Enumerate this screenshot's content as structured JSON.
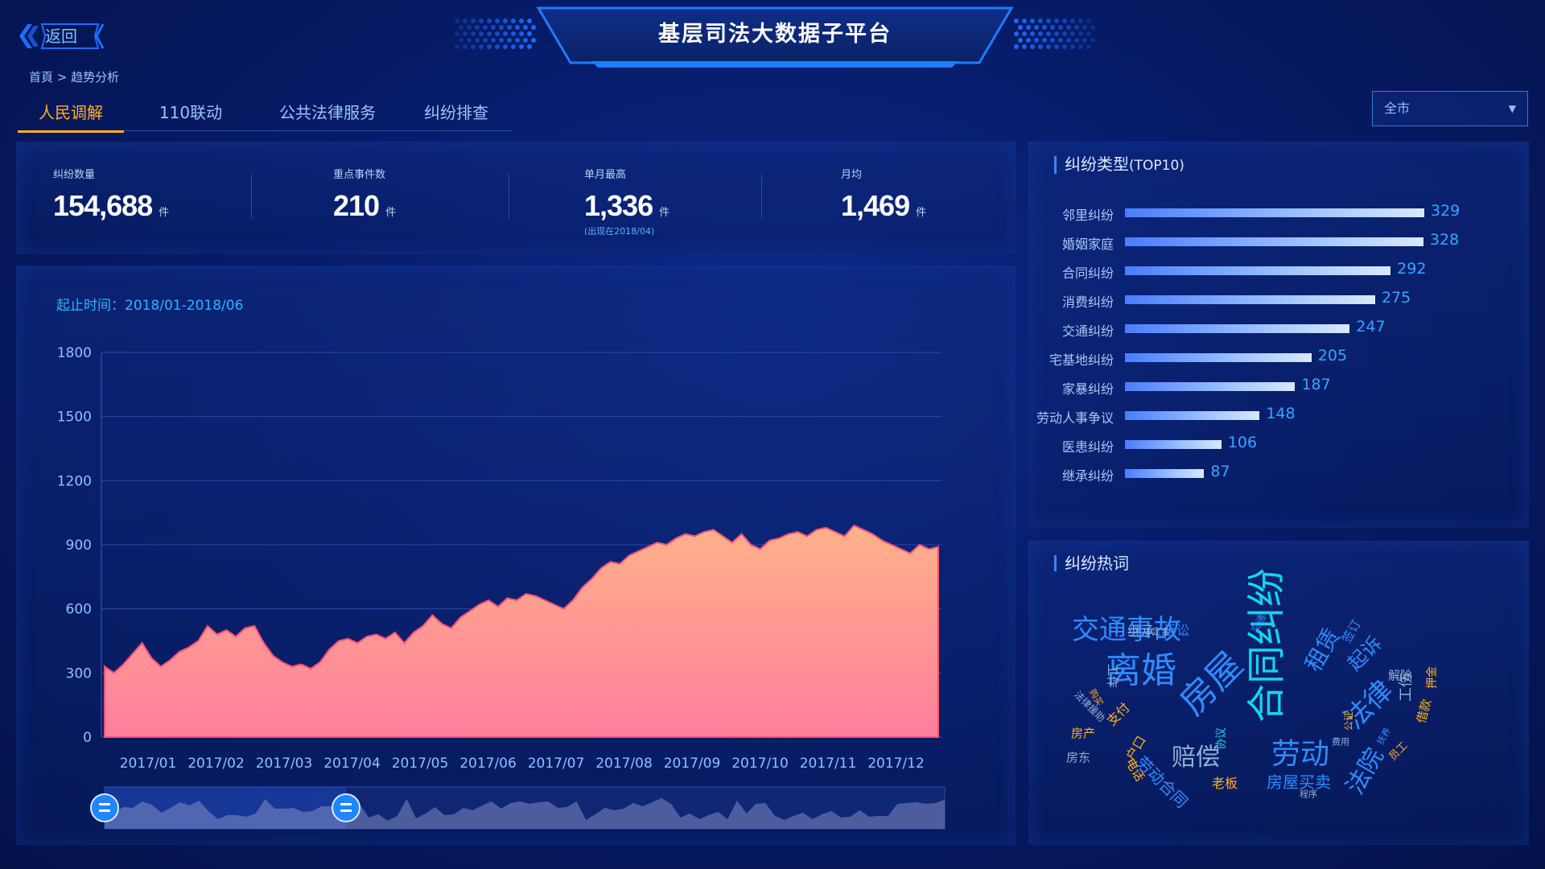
{
  "header": {
    "back_label": "返回",
    "title": "基层司法大数据子平台"
  },
  "breadcrumb": "首頁 > 趋势分析",
  "tabs": [
    "人民调解",
    "110联动",
    "公共法律服务",
    "纠纷排查"
  ],
  "region_select": {
    "value": "全市",
    "caret": "▼"
  },
  "stats": [
    {
      "label": "纠纷数量",
      "value": "154,688",
      "unit": "件",
      "note": ""
    },
    {
      "label": "重点事件数",
      "value": "210",
      "unit": "件",
      "note": ""
    },
    {
      "label": "单月最高",
      "value": "1,336",
      "unit": "件",
      "note": "(出现在2018/04)"
    },
    {
      "label": "月均",
      "value": "1,469",
      "unit": "件",
      "note": ""
    }
  ],
  "date_range": "起止时间：2018/01-2018/06",
  "colors": {
    "accent": "#2f8cff",
    "tab_active": "#ffb21f",
    "area_top": "#ffb189",
    "area_bottom": "#ff7e9d",
    "area_line": "#ff4f7b"
  },
  "chart_data": [
    {
      "type": "area",
      "title": "",
      "xlabel": "",
      "ylabel": "",
      "ylim": [
        0,
        1800
      ],
      "yticks": [
        0,
        300,
        600,
        900,
        1200,
        1500,
        1800
      ],
      "x_tick_labels": [
        "2017/01",
        "2017/02",
        "2017/03",
        "2017/04",
        "2017/05",
        "2017/06",
        "2017/07",
        "2017/08",
        "2017/09",
        "2017/10",
        "2017/11",
        "2017/12"
      ],
      "grid": true,
      "values": [
        330,
        300,
        340,
        390,
        440,
        370,
        330,
        360,
        400,
        420,
        450,
        520,
        480,
        500,
        470,
        510,
        520,
        440,
        380,
        350,
        330,
        340,
        320,
        350,
        410,
        450,
        460,
        440,
        470,
        480,
        460,
        490,
        440,
        490,
        520,
        570,
        530,
        510,
        560,
        590,
        620,
        640,
        610,
        650,
        640,
        670,
        660,
        640,
        620,
        600,
        640,
        700,
        740,
        790,
        820,
        810,
        850,
        870,
        890,
        910,
        900,
        930,
        950,
        940,
        960,
        970,
        940,
        910,
        950,
        900,
        880,
        920,
        930,
        950,
        960,
        940,
        970,
        980,
        960,
        940,
        990,
        970,
        950,
        920,
        900,
        880,
        860,
        900,
        880,
        890
      ]
    },
    {
      "type": "bar",
      "title": "纠纷类型",
      "subtitle": "(TOP10)",
      "categories": [
        "邻里纠纷",
        "婚姻家庭",
        "合同纠纷",
        "消费纠纷",
        "交通纠纷",
        "宅基地纠纷",
        "家暴纠纷",
        "劳动人事争议",
        "医患纠纷",
        "继承纠纷"
      ],
      "values": [
        329,
        328,
        292,
        275,
        247,
        205,
        187,
        148,
        106,
        87
      ],
      "orientation": "horizontal"
    }
  ],
  "hot_words": {
    "title": "纠纷热词",
    "words": [
      "合同纠纷",
      "离婚",
      "房屋",
      "劳动",
      "法律",
      "交通事故",
      "法院",
      "赔偿",
      "租赁",
      "起诉",
      "房屋买卖",
      "劳动合同",
      "继承",
      "诉讼",
      "签订",
      "户口",
      "支付",
      "工作",
      "房产",
      "房东",
      "老板",
      "电话",
      "协议",
      "工伤",
      "解除",
      "借款",
      "押金",
      "定金",
      "员工",
      "公证",
      "抚养",
      "程序",
      "法律援助",
      "购买",
      "交通",
      "费用"
    ]
  }
}
